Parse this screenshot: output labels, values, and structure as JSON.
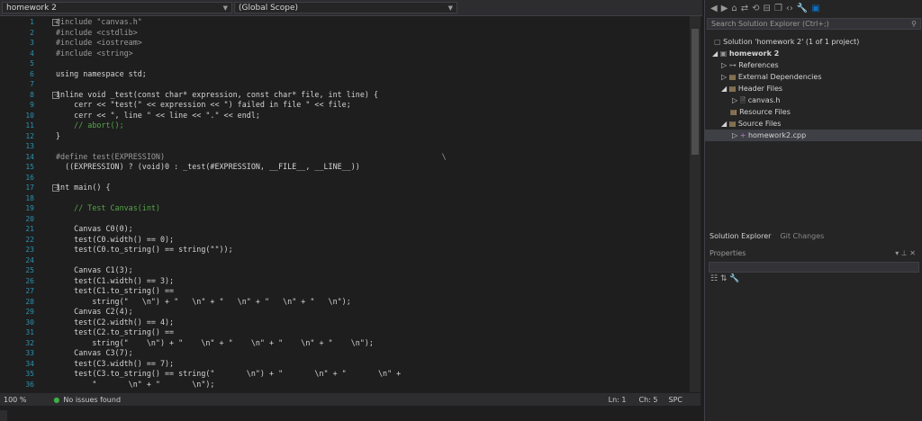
{
  "toolbar": {
    "project_combo": "homework 2",
    "scope_combo": "(Global Scope)"
  },
  "editor": {
    "line_numbers": [
      "1",
      "2",
      "3",
      "4",
      "5",
      "6",
      "7",
      "8",
      "9",
      "10",
      "11",
      "12",
      "13",
      "14",
      "15",
      "16",
      "17",
      "18",
      "19",
      "20",
      "21",
      "22",
      "23",
      "24",
      "25",
      "26",
      "27",
      "28",
      "29",
      "30",
      "31",
      "32",
      "33",
      "34",
      "35",
      "36"
    ],
    "lines": [
      "#include \"canvas.h\"",
      "#include <cstdlib>",
      "#include <iostream>",
      "#include <string>",
      "",
      "using namespace std;",
      "",
      "inline void _test(const char* expression, const char* file, int line) {",
      "    cerr << \"test(\" << expression << \") failed in file \" << file;",
      "    cerr << \", line \" << line << \".\" << endl;",
      "    // abort();",
      "}",
      "",
      "#define test(EXPRESSION)                                                             \\",
      "  ((EXPRESSION) ? (void)0 : _test(#EXPRESSION, __FILE__, __LINE__))",
      "",
      "int main() {",
      "",
      "    // Test Canvas(int)",
      "",
      "    Canvas C0(0);",
      "    test(C0.width() == 0);",
      "    test(C0.to_string() == string(\"\"));",
      "",
      "    Canvas C1(3);",
      "    test(C1.width() == 3);",
      "    test(C1.to_string() ==",
      "        string(\"   \\n\") + \"   \\n\" + \"   \\n\" + \"   \\n\" + \"   \\n\");",
      "    Canvas C2(4);",
      "    test(C2.width() == 4);",
      "    test(C2.to_string() ==",
      "        string(\"    \\n\") + \"    \\n\" + \"    \\n\" + \"    \\n\" + \"    \\n\");",
      "    Canvas C3(7);",
      "    test(C3.width() == 7);",
      "    test(C3.to_string() == string(\"       \\n\") + \"       \\n\" + \"       \\n\" +",
      "        \"       \\n\" + \"       \\n\");"
    ]
  },
  "statusbar": {
    "zoom": "100 %",
    "issues": "No issues found",
    "ln": "Ln: 1",
    "ch": "Ch: 5",
    "spc": "SPC"
  },
  "solution_explorer": {
    "search_placeholder": "Search Solution Explorer (Ctrl+;)",
    "solution": "Solution 'homework 2' (1 of 1 project)",
    "project": "homework 2",
    "references": "References",
    "external": "External Dependencies",
    "header_files": "Header Files",
    "canvas_h": "canvas.h",
    "resource_files": "Resource Files",
    "source_files": "Source Files",
    "homework2_cpp": "homework2.cpp"
  },
  "panel_tabs": {
    "solution_explorer": "Solution Explorer",
    "git_changes": "Git Changes"
  },
  "properties": {
    "title": "Properties"
  },
  "colors": {
    "background": "#1e1e1e",
    "keyword": "#569cd6",
    "string": "#d69d85",
    "comment": "#57a64a",
    "type": "#4ec9b0",
    "line_number": "#2b91af"
  }
}
